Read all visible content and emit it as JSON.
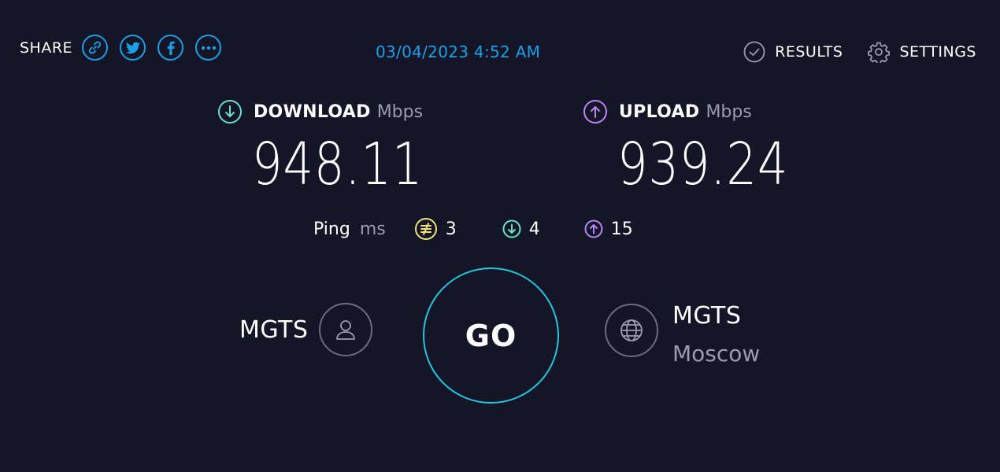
{
  "header": {
    "share_label": "SHARE",
    "share_buttons": [
      "link-icon",
      "twitter-icon",
      "facebook-icon",
      "more-icon"
    ],
    "timestamp": "03/04/2023 4:52 AM",
    "results_label": "RESULTS",
    "settings_label": "SETTINGS"
  },
  "download": {
    "label": "DOWNLOAD",
    "unit": "Mbps",
    "value": "948.11"
  },
  "upload": {
    "label": "UPLOAD",
    "unit": "Mbps",
    "value": "939.24"
  },
  "ping": {
    "label": "Ping",
    "unit": "ms",
    "idle": "3",
    "download": "4",
    "upload": "15"
  },
  "go_label": "GO",
  "isp": {
    "name": "MGTS"
  },
  "server": {
    "name": "MGTS",
    "location": "Moscow"
  },
  "colors": {
    "background": "#141526",
    "accent": "#1ba0e8",
    "download": "#67e0d0",
    "upload": "#b985f5",
    "idle_ping": "#f2e27a",
    "go_ring": "#22c8e0",
    "muted": "#9a9bb1"
  }
}
